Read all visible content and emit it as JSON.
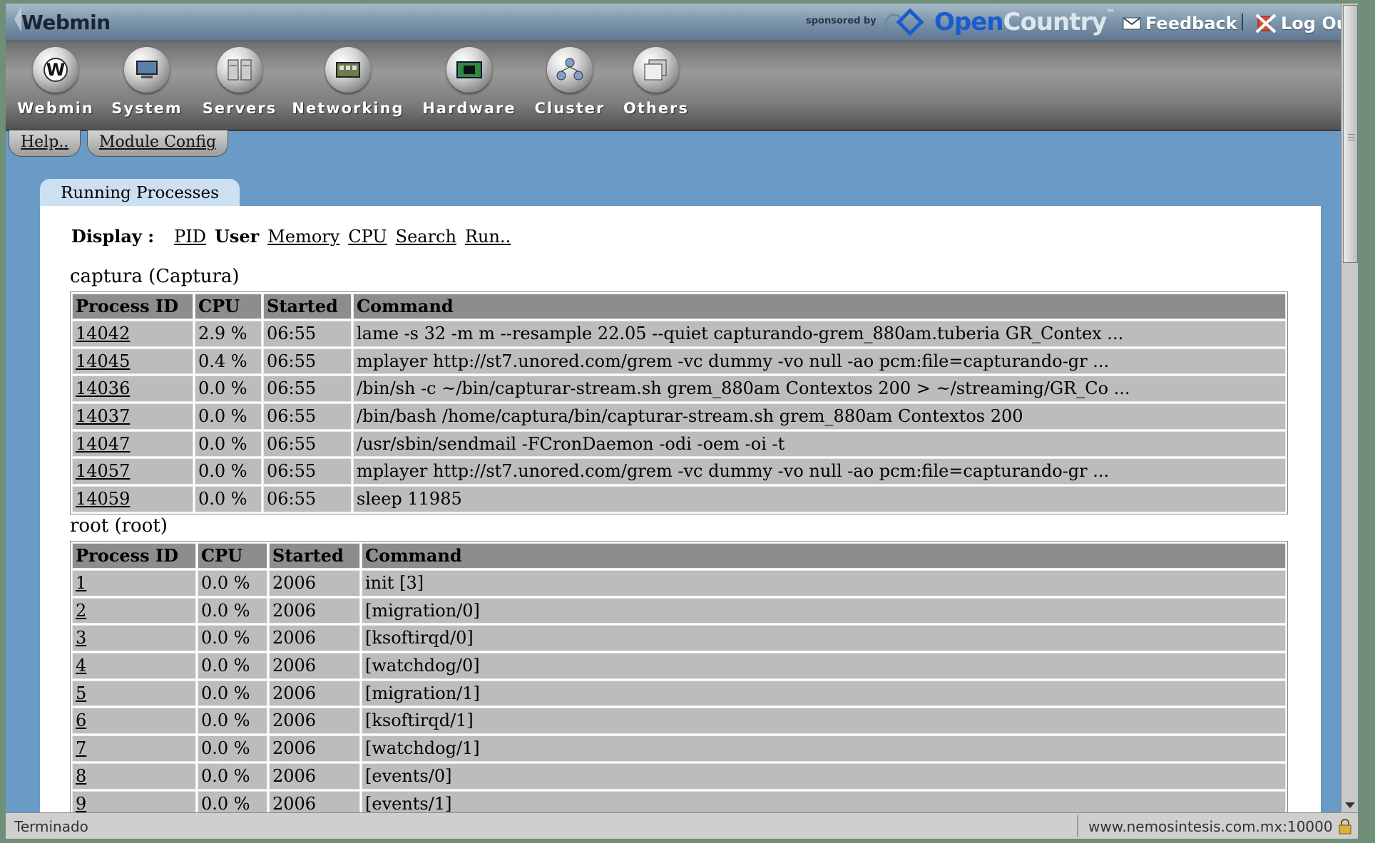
{
  "topbar": {
    "brand": "Webmin",
    "sponsored_by": "sponsored by",
    "sponsor_lead": "Open",
    "sponsor_rest": "Country",
    "sponsor_tm": "™",
    "feedback": "Feedback",
    "logout": "Log Out"
  },
  "categories": [
    {
      "label": "Webmin",
      "icon": "webmin-icon"
    },
    {
      "label": "System",
      "icon": "system-icon"
    },
    {
      "label": "Servers",
      "icon": "servers-icon"
    },
    {
      "label": "Networking",
      "icon": "networking-icon"
    },
    {
      "label": "Hardware",
      "icon": "hardware-icon"
    },
    {
      "label": "Cluster",
      "icon": "cluster-icon"
    },
    {
      "label": "Others",
      "icon": "others-icon"
    }
  ],
  "help_tabs": {
    "help": "Help..",
    "module_config": "Module Config"
  },
  "panel": {
    "title": "Running Processes",
    "display_label": "Display :",
    "display_current": "User",
    "display_links": {
      "pid": "PID",
      "memory": "Memory",
      "cpu": "CPU",
      "search": "Search",
      "run": "Run.."
    }
  },
  "columns": {
    "pid": "Process ID",
    "cpu": "CPU",
    "started": "Started",
    "command": "Command"
  },
  "groups": [
    {
      "title": "captura (Captura)",
      "rows": [
        {
          "pid": "14042",
          "cpu": "2.9 %",
          "started": "06:55",
          "command": "lame -s 32 -m m --resample 22.05 --quiet capturando-grem_880am.tuberia GR_Contex ..."
        },
        {
          "pid": "14045",
          "cpu": "0.4 %",
          "started": "06:55",
          "command": "mplayer http://st7.unored.com/grem -vc dummy -vo null -ao pcm:file=capturando-gr ..."
        },
        {
          "pid": "14036",
          "cpu": "0.0 %",
          "started": "06:55",
          "command": "/bin/sh -c ~/bin/capturar-stream.sh grem_880am Contextos 200 > ~/streaming/GR_Co ..."
        },
        {
          "pid": "14037",
          "cpu": "0.0 %",
          "started": "06:55",
          "command": "/bin/bash /home/captura/bin/capturar-stream.sh grem_880am Contextos 200"
        },
        {
          "pid": "14047",
          "cpu": "0.0 %",
          "started": "06:55",
          "command": "/usr/sbin/sendmail -FCronDaemon -odi -oem -oi -t"
        },
        {
          "pid": "14057",
          "cpu": "0.0 %",
          "started": "06:55",
          "command": "mplayer http://st7.unored.com/grem -vc dummy -vo null -ao pcm:file=capturando-gr ..."
        },
        {
          "pid": "14059",
          "cpu": "0.0 %",
          "started": "06:55",
          "command": "sleep 11985"
        }
      ]
    },
    {
      "title": "root (root)",
      "rows": [
        {
          "pid": "1",
          "cpu": "0.0 %",
          "started": "2006",
          "command": "init [3]"
        },
        {
          "pid": "2",
          "cpu": "0.0 %",
          "started": "2006",
          "command": "[migration/0]"
        },
        {
          "pid": "3",
          "cpu": "0.0 %",
          "started": "2006",
          "command": "[ksoftirqd/0]"
        },
        {
          "pid": "4",
          "cpu": "0.0 %",
          "started": "2006",
          "command": "[watchdog/0]"
        },
        {
          "pid": "5",
          "cpu": "0.0 %",
          "started": "2006",
          "command": "[migration/1]"
        },
        {
          "pid": "6",
          "cpu": "0.0 %",
          "started": "2006",
          "command": "[ksoftirqd/1]"
        },
        {
          "pid": "7",
          "cpu": "0.0 %",
          "started": "2006",
          "command": "[watchdog/1]"
        },
        {
          "pid": "8",
          "cpu": "0.0 %",
          "started": "2006",
          "command": "[events/0]"
        },
        {
          "pid": "9",
          "cpu": "0.0 %",
          "started": "2006",
          "command": "[events/1]"
        }
      ]
    }
  ],
  "statusbar": {
    "text": "Terminado",
    "url": "www.nemosintesis.com.mx:10000"
  }
}
